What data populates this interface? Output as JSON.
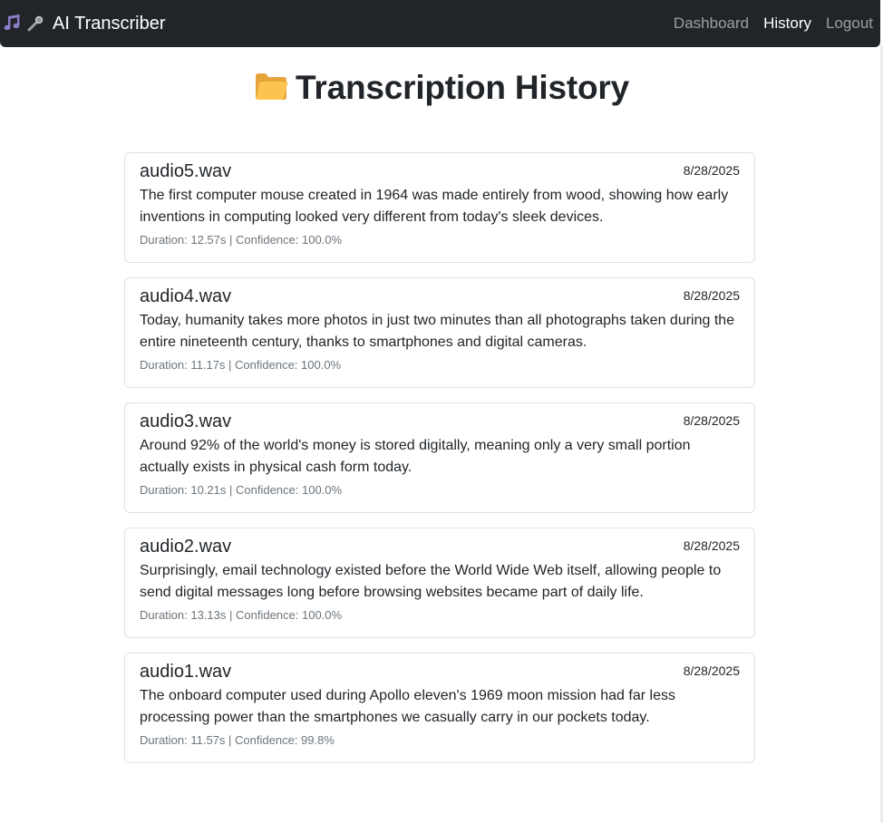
{
  "brand": {
    "title": "AI Transcriber",
    "icons": [
      "music-note-icon",
      "microphone-icon"
    ]
  },
  "nav": {
    "items": [
      {
        "label": "Dashboard",
        "active": false
      },
      {
        "label": "History",
        "active": true
      },
      {
        "label": "Logout",
        "active": false
      }
    ]
  },
  "page": {
    "title": "Transcription History",
    "title_icon": "folder-icon"
  },
  "transcriptions": [
    {
      "filename": "audio5.wav",
      "date": "8/28/2025",
      "text": "The first computer mouse created in 1964 was made entirely from wood, showing how early inventions in computing looked very different from today's sleek devices.",
      "meta": "Duration: 12.57s | Confidence: 100.0%"
    },
    {
      "filename": "audio4.wav",
      "date": "8/28/2025",
      "text": "Today, humanity takes more photos in just two minutes than all photographs taken during the entire nineteenth century, thanks to smartphones and digital cameras.",
      "meta": "Duration: 11.17s | Confidence: 100.0%"
    },
    {
      "filename": "audio3.wav",
      "date": "8/28/2025",
      "text": "Around 92% of the world's money is stored digitally, meaning only a very small portion actually exists in physical cash form today.",
      "meta": "Duration: 10.21s | Confidence: 100.0%"
    },
    {
      "filename": "audio2.wav",
      "date": "8/28/2025",
      "text": "Surprisingly, email technology existed before the World Wide Web itself, allowing people to send digital messages long before browsing websites became part of daily life.",
      "meta": "Duration: 13.13s | Confidence: 100.0%"
    },
    {
      "filename": "audio1.wav",
      "date": "8/28/2025",
      "text": "The onboard computer used during Apollo eleven's 1969 moon mission had far less processing power than the smartphones we casually carry in our pockets today.",
      "meta": "Duration: 11.57s | Confidence: 99.8%"
    }
  ],
  "colors": {
    "navbar_bg": "#212529",
    "nav_link": "#a6a8aa",
    "nav_active": "#ffffff",
    "card_border": "#dee2e6",
    "meta_text": "#6c757d"
  }
}
